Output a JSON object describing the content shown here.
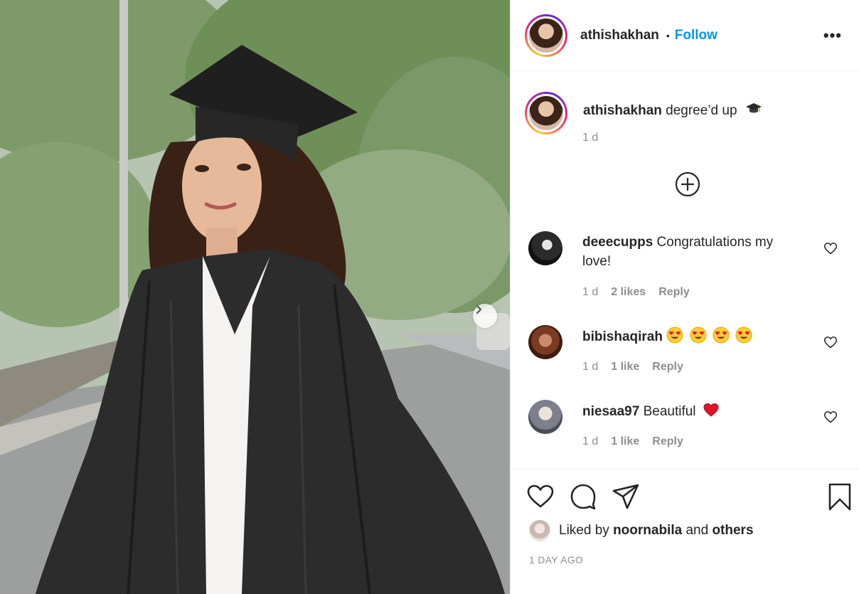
{
  "post": {
    "author": "athishakhan",
    "separator": "•",
    "follow_label": "Follow",
    "more_label": "•••"
  },
  "caption": {
    "username": "athishakhan",
    "text": "degree’d up",
    "emoji_icon": "graduation-cap-icon",
    "time": "1 d"
  },
  "load_more_icon": "plus-circle-icon",
  "comments": [
    {
      "username": "deeecupps",
      "text": "Congratulations my love!",
      "emoji": "",
      "time": "1 d",
      "likes": "2 likes",
      "reply": "Reply"
    },
    {
      "username": "bibishaqirah",
      "text": "",
      "emoji": "heart-eyes x4",
      "time": "1 d",
      "likes": "1 like",
      "reply": "Reply"
    },
    {
      "username": "niesaa97",
      "text": "Beautiful",
      "emoji": "red-heart",
      "time": "1 d",
      "likes": "1 like",
      "reply": "Reply"
    }
  ],
  "footer": {
    "liked_prefix": "Liked by",
    "liked_user": "noornabila",
    "liked_and": "and",
    "liked_others": "others",
    "timestamp": "1 DAY AGO"
  },
  "colors": {
    "accent": "#0095f6",
    "text": "#262626",
    "muted": "#8e8e8e",
    "border": "#efefef"
  }
}
